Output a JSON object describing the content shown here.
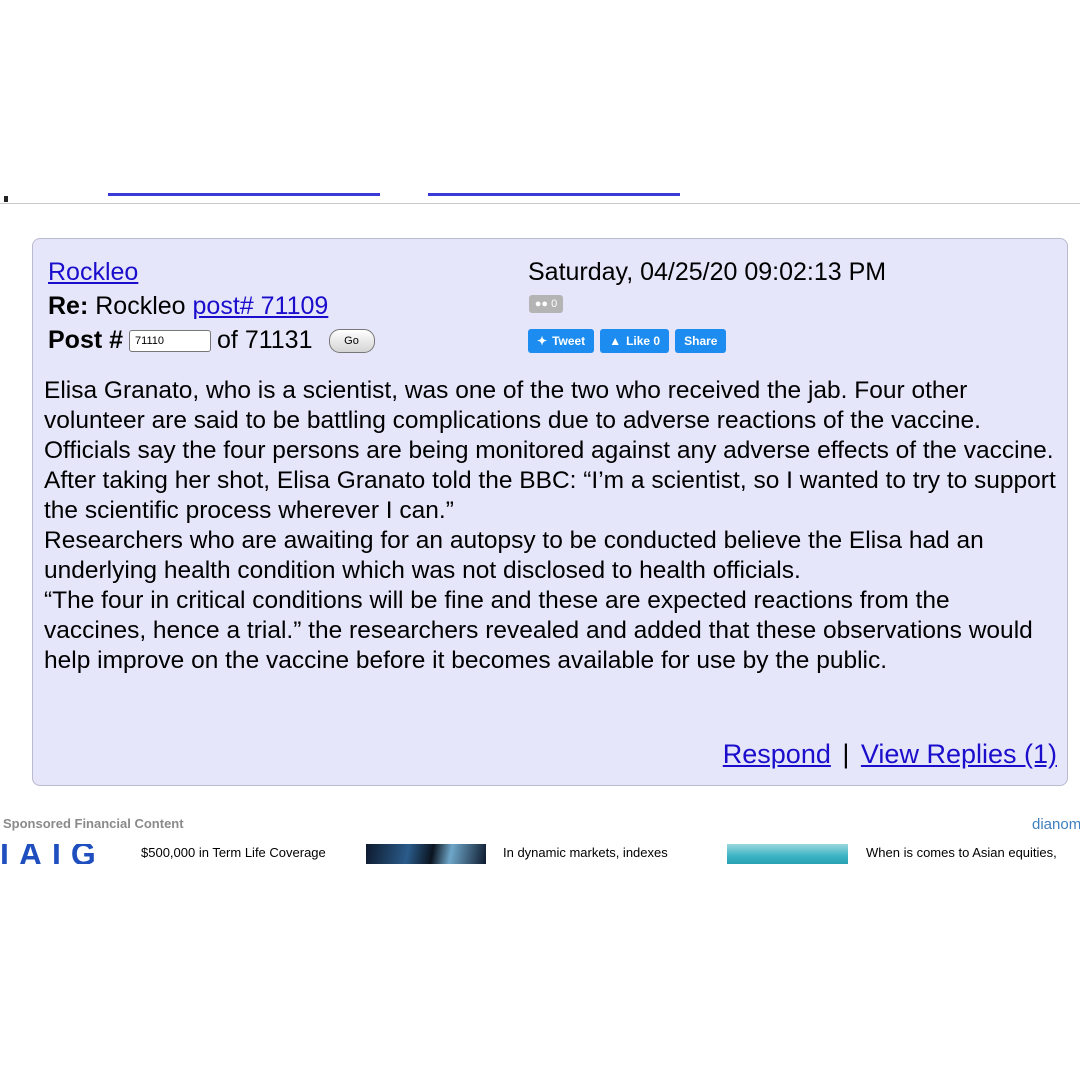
{
  "post": {
    "author": "Rockleo",
    "re_label": "Re:",
    "re_author": "Rockleo",
    "re_post_link": "post# 71109",
    "post_label": "Post #",
    "post_input_value": "71110",
    "of_total": "of 71131",
    "go_label": "Go",
    "date": "Saturday, 04/25/20 09:02:13 PM",
    "comment_badge": "0",
    "social": {
      "tweet": "Tweet",
      "like": "Like 0",
      "share": "Share"
    },
    "paragraphs": [
      "Elisa Granato, who is a scientist, was one of the two who received the jab. Four other volunteer are said to be battling complications due to adverse reactions of the vaccine. Officials say the four persons are being monitored against any adverse effects of the vaccine.",
      "After taking her shot, Elisa Granato told the BBC: “I’m a scientist, so I wanted to try to support the scientific process wherever I can.”",
      "Researchers who are awaiting for an autopsy to be conducted believe the Elisa had an underlying health condition which was not disclosed to health officials.",
      "“The four in critical conditions will be fine and these are expected reactions from the vaccines, hence a trial.” the researchers revealed and added that these observations would help improve on the vaccine before it becomes available for use by the public."
    ],
    "respond_label": "Respond",
    "separator": "|",
    "view_replies_label": "View Replies (1)"
  },
  "sponsored": {
    "title": "Sponsored Financial Content",
    "brand": "dianomi",
    "items": [
      "$500,000 in Term Life Coverage",
      "In dynamic markets, indexes",
      "When is comes to Asian equities,"
    ]
  },
  "colors": {
    "panel_bg": "#e6e6fa",
    "link": "#1a0dcc",
    "social_button": "#1d8cf0"
  }
}
